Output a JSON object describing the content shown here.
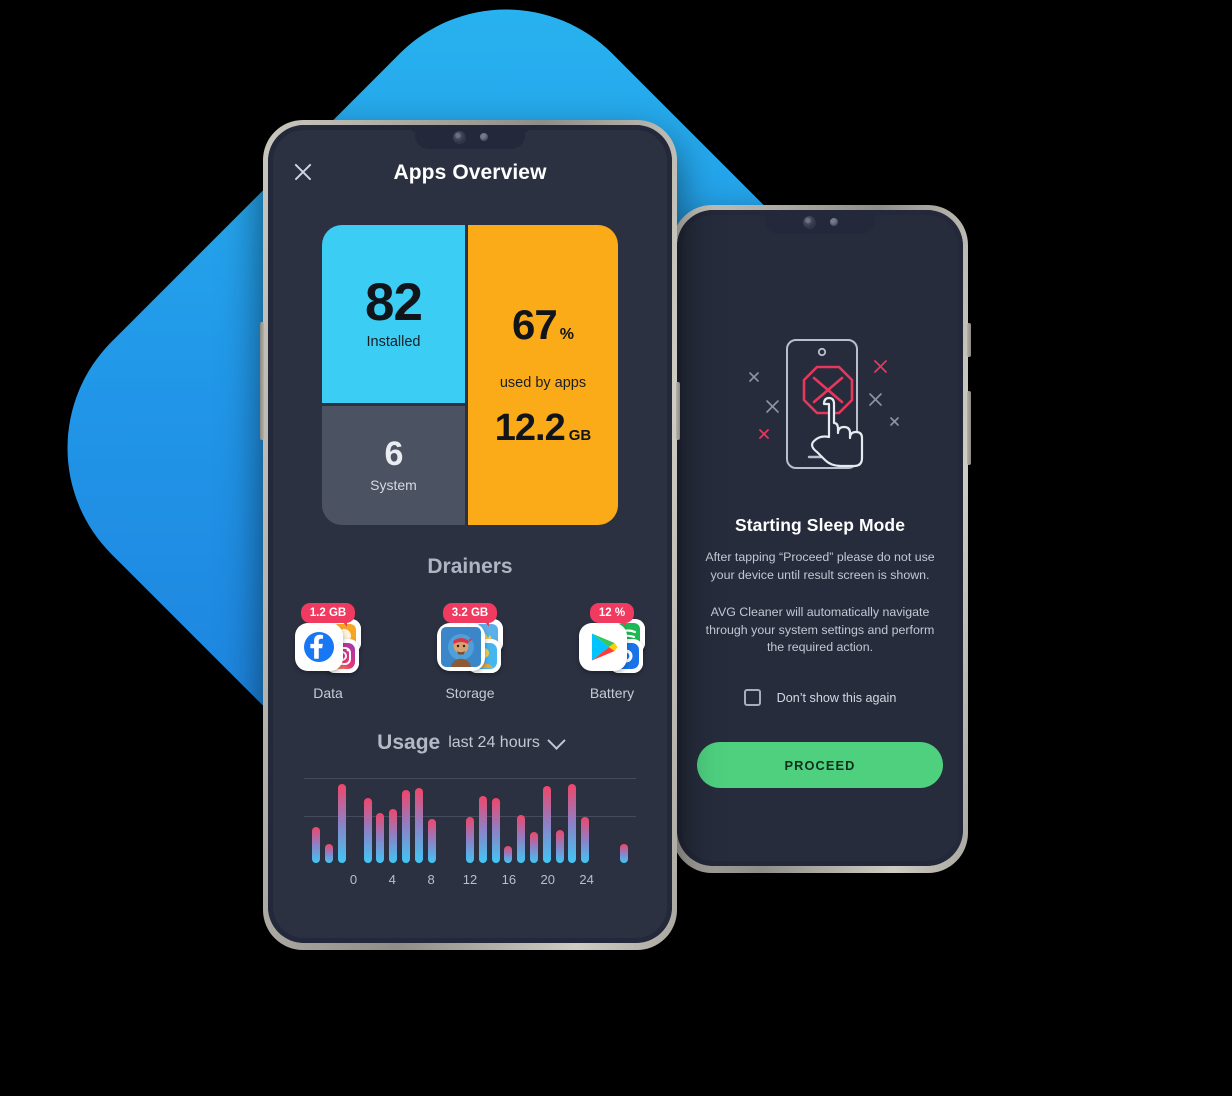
{
  "front_phone": {
    "appbar": {
      "close_icon": "close-x-icon",
      "title": "Apps Overview"
    },
    "cards": {
      "installed": {
        "value": "82",
        "label": "Installed",
        "color": "#3ccdf5"
      },
      "system": {
        "value": "6",
        "label": "System",
        "color": "#4b5262"
      },
      "storage": {
        "percent": "67",
        "percent_unit": "%",
        "caption": "used by apps",
        "size": "12.2",
        "size_unit": "GB",
        "color": "#fbab17"
      }
    },
    "drainers": {
      "title": "Drainers",
      "items": [
        {
          "badge": "1.2 GB",
          "label": "Data",
          "icon": "facebook-icon"
        },
        {
          "badge": "3.2 GB",
          "label": "Storage",
          "icon": "game-app-icon"
        },
        {
          "badge": "12 %",
          "label": "Battery",
          "icon": "play-store-icon"
        }
      ],
      "badge_color": "#f03a5f"
    },
    "usage": {
      "title": "Usage",
      "range": "last 24 hours",
      "chevron_icon": "chevron-down-icon"
    }
  },
  "back_phone": {
    "illustration_icon": "phone-blocked-tap-icon",
    "title": "Starting Sleep Mode",
    "paragraph_1": "After tapping “Proceed” please do not use your device until result screen is shown.",
    "paragraph_2": "AVG Cleaner will automatically navigate through your system settings and perform the required action.",
    "checkbox_label": "Don’t show this again",
    "checkbox_checked": false,
    "proceed_label": "PROCEED",
    "proceed_color": "#4ed07f"
  },
  "theme": {
    "background": "#000000",
    "diamond_from": "#29b6f0",
    "diamond_to": "#1b78d8",
    "screen_bg": "#2b3141"
  },
  "chart_data": {
    "type": "bar",
    "title": "Usage",
    "subtitle": "last 24 hours",
    "xlabel": "",
    "ylabel": "",
    "x": [
      0,
      1,
      2,
      3,
      4,
      5,
      6,
      7,
      8,
      9,
      10,
      11,
      12,
      13,
      14,
      15,
      16,
      17,
      18,
      19,
      20,
      21,
      22,
      23,
      24
    ],
    "values": [
      34,
      18,
      76,
      0,
      62,
      48,
      52,
      70,
      72,
      42,
      0,
      0,
      44,
      64,
      62,
      16,
      46,
      30,
      74,
      32,
      76,
      44,
      0,
      0,
      18
    ],
    "tick_labels": [
      "0",
      "4",
      "8",
      "12",
      "16",
      "20",
      "24"
    ],
    "tick_positions": [
      0,
      4,
      8,
      12,
      16,
      20,
      24
    ],
    "ylim": [
      0,
      88
    ],
    "grid": true,
    "gridlines": [
      44,
      80
    ],
    "bar_gradient": [
      "#f0466a",
      "#8f7fc4",
      "#3fc7f5"
    ],
    "legend": null
  }
}
